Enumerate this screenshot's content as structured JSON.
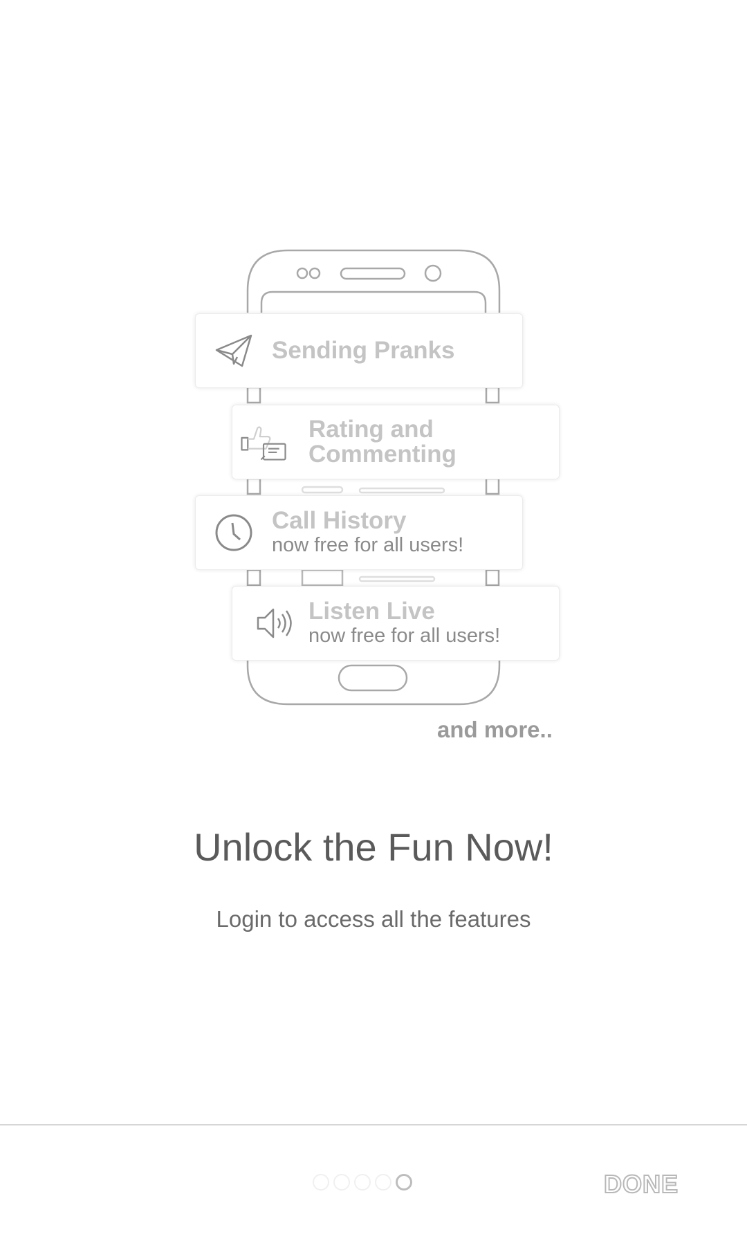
{
  "features": [
    {
      "title": "Sending Pranks",
      "subtitle": "",
      "icon": "paper-plane-icon"
    },
    {
      "title": "Rating and\nCommenting",
      "title_line1": "Rating and",
      "title_line2": "Commenting",
      "subtitle": "",
      "icon": "thumbs-up-comment-icon"
    },
    {
      "title": "Call History",
      "subtitle": "now free for all users!",
      "icon": "clock-icon"
    },
    {
      "title": "Listen Live",
      "subtitle": "now free for all users!",
      "icon": "speaker-icon"
    }
  ],
  "and_more": "and more..",
  "headline": "Unlock the Fun Now!",
  "subline": "Login to access all the features",
  "pager": {
    "total": 5,
    "active": 5
  },
  "done_label": "DONE",
  "colors": {
    "background": "#ffffff",
    "outline": "#a8a8a8",
    "card_title": "#c4c4c4",
    "text": "#5a5a5a"
  }
}
